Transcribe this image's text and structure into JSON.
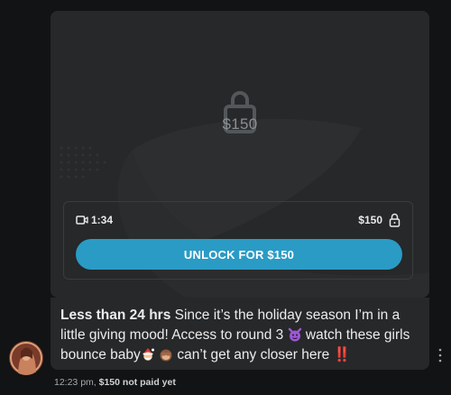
{
  "post": {
    "locked_price": "$150",
    "video_duration": "1:34",
    "price_label": "$150",
    "unlock_button_label": "UNLOCK FOR $150"
  },
  "message": {
    "bold_lead": "Less than 24 hrs",
    "text_part1": " Since it’s the holiday season I’m in a little giving mood! Access to round 3",
    "text_part2": " watch these girls bounce baby",
    "text_part3": " can’t get any closer here ‼️"
  },
  "footer": {
    "time": "12:23 pm,",
    "payment_status": "$150 not paid yet"
  },
  "icons": {
    "lock": "lock-icon",
    "video": "video-camera-icon",
    "small_lock": "lock-icon",
    "devil": "smiling-devil-emoji",
    "santa": "santa-emoji",
    "monkey": "see-no-evil-monkey-emoji",
    "menu": "more-vertical-icon"
  },
  "colors": {
    "button": "#2a9bc5",
    "card_background": "#26282a",
    "page_background": "#121314"
  }
}
